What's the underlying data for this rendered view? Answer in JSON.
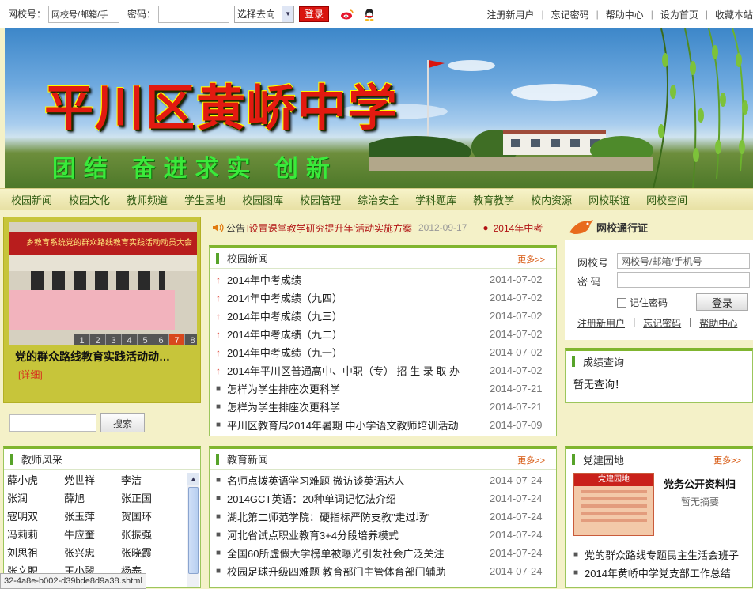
{
  "topbar": {
    "school_id_label": "网校号：",
    "school_id_placeholder": "网校号/邮箱/手",
    "password_label": "密码：",
    "select_value": "选择去向",
    "login_label": "登录",
    "links": [
      "注册新用户",
      "忘记密码",
      "帮助中心",
      "设为首页",
      "收藏本站"
    ]
  },
  "banner": {
    "title": "平川区黄峤中学",
    "slogan": "团结 奋进求实 创新"
  },
  "nav": [
    "校园新闻",
    "校园文化",
    "教师频道",
    "学生园地",
    "校园图库",
    "校园管理",
    "综治安全",
    "学科题库",
    "教育教学",
    "校内资源",
    "网校联谊",
    "网校空间"
  ],
  "slideshow": {
    "banner_text": "乡教育系统党的群众路线教育实践活动动员大会",
    "numbers": [
      "1",
      "2",
      "3",
      "4",
      "5",
      "6",
      "7",
      "8"
    ],
    "active": "7",
    "caption": "党的群众路线教育实践活动动…",
    "detail": "[详细]"
  },
  "search": {
    "button": "搜索"
  },
  "notice": {
    "label": "公告",
    "text": "l设置课堂教学研究提升年'活动实施方案",
    "date": "2012-09-17",
    "next": "2014年中考"
  },
  "campus_news": {
    "title": "校园新闻",
    "more": "更多>>",
    "items": [
      {
        "mark": "up",
        "title": "2014年中考成绩",
        "date": "2014-07-02"
      },
      {
        "mark": "up",
        "title": "2014年中考成绩（九四）",
        "date": "2014-07-02"
      },
      {
        "mark": "up",
        "title": "2014年中考成绩（九三）",
        "date": "2014-07-02"
      },
      {
        "mark": "up",
        "title": "2014年中考成绩（九二）",
        "date": "2014-07-02"
      },
      {
        "mark": "up",
        "title": "2014年中考成绩（九一）",
        "date": "2014-07-02"
      },
      {
        "mark": "up",
        "title": "2014年平川区普通高中、中职（专） 招 生 录 取 办",
        "date": "2014-07-02"
      },
      {
        "mark": "dot",
        "title": "怎样为学生排座次更科学",
        "date": "2014-07-21"
      },
      {
        "mark": "dot",
        "title": "怎样为学生排座次更科学",
        "date": "2014-07-21"
      },
      {
        "mark": "dot",
        "title": "平川区教育局2014年暑期 中小学语文教师培训活动",
        "date": "2014-07-09"
      }
    ]
  },
  "edu_news": {
    "title": "教育新闻",
    "more": "更多>>",
    "items": [
      {
        "mark": "dot",
        "title": "名师点拨英语学习难题 微访谈英语达人",
        "date": "2014-07-24"
      },
      {
        "mark": "dot",
        "title": "2014GCT英语：20种单词记忆法介绍",
        "date": "2014-07-24"
      },
      {
        "mark": "dot",
        "title": "湖北第二师范学院：硬指标严防支教\"走过场\"",
        "date": "2014-07-24"
      },
      {
        "mark": "dot",
        "title": "河北省试点职业教育3+4分段培养模式",
        "date": "2014-07-24"
      },
      {
        "mark": "dot",
        "title": "全国60所虚假大学榜单被曝光引发社会广泛关注",
        "date": "2014-07-24"
      },
      {
        "mark": "dot",
        "title": "校园足球升级四难题 教育部门主管体育部门辅助",
        "date": "2014-07-24"
      }
    ]
  },
  "pass": {
    "title": "网校通行证",
    "id_label": "网校号",
    "id_placeholder": "网校号/邮箱/手机号",
    "pwd_label": "密 码",
    "remember": "记住密码",
    "login": "登录",
    "links": [
      "注册新用户",
      "忘记密码",
      "帮助中心"
    ]
  },
  "scores": {
    "title": "成绩查询",
    "text": "暂无查询！"
  },
  "teachers": {
    "title": "教师风采",
    "names": [
      "薛小虎",
      "党世祥",
      "李洁",
      "张润",
      "薛旭",
      "张正国",
      "寇明双",
      "张玉萍",
      "贺国环",
      "冯莉莉",
      "牛应奎",
      "张振强",
      "刘思祖",
      "张兴忠",
      "张晓霞",
      "张文职",
      "王小翠",
      "杨泰"
    ]
  },
  "party": {
    "title": "党建园地",
    "more": "更多>>",
    "img_text": "党建园地",
    "headline": "党务公开资料归",
    "sub": "暂无摘要",
    "items": [
      "党的群众路线专题民主生活会班子",
      "2014年黄峤中学党支部工作总结"
    ]
  },
  "statusbar": "32-4a8e-b002-d39bde8d9a38.shtml",
  "colors": {
    "accent_green": "#80b52f",
    "nav_text": "#2f5b12",
    "link_orange": "#d6550c",
    "alert_red": "#d61a0b"
  }
}
